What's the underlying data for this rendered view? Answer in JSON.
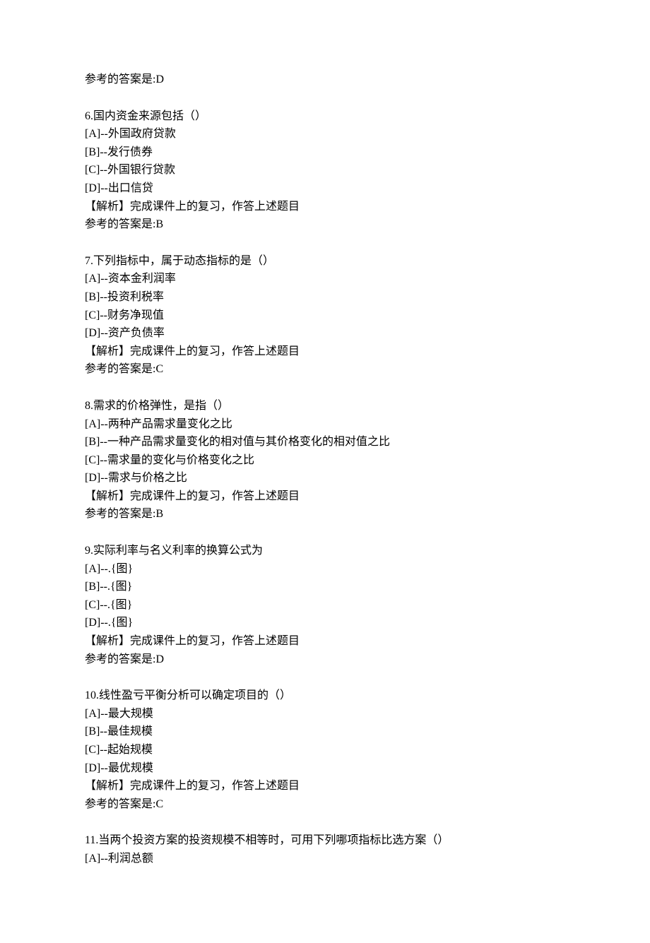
{
  "q5_trail": {
    "answer_line": "参考的答案是:D"
  },
  "q6": {
    "number": "6.",
    "stem": "国内资金来源包括（）",
    "opts": [
      "[A]--外国政府贷款",
      "[B]--发行债券",
      "[C]--外国银行贷款",
      "[D]--出口信贷"
    ],
    "explain": "【解析】完成课件上的复习，作答上述题目",
    "answer_line": "参考的答案是:B"
  },
  "q7": {
    "number": "7.",
    "stem": "下列指标中，属于动态指标的是（）",
    "opts": [
      "[A]--资本金利润率",
      "[B]--投资利税率",
      "[C]--财务净现值",
      "[D]--资产负债率"
    ],
    "explain": "【解析】完成课件上的复习，作答上述题目",
    "answer_line": "参考的答案是:C"
  },
  "q8": {
    "number": "8.",
    "stem": "需求的价格弹性，是指（）",
    "opts": [
      "[A]--两种产品需求量变化之比",
      "[B]--一种产品需求量变化的相对值与其价格变化的相对值之比",
      "[C]--需求量的变化与价格变化之比",
      "[D]--需求与价格之比"
    ],
    "explain": "【解析】完成课件上的复习，作答上述题目",
    "answer_line": "参考的答案是:B"
  },
  "q9": {
    "number": "9.",
    "stem": "实际利率与名义利率的换算公式为",
    "opts": [
      "[A]--.{图}",
      "[B]--.{图}",
      "[C]--.{图}",
      "[D]--.{图}"
    ],
    "explain": "【解析】完成课件上的复习，作答上述题目",
    "answer_line": "参考的答案是:D"
  },
  "q10": {
    "number": "10.",
    "stem": "线性盈亏平衡分析可以确定项目的（）",
    "opts": [
      "[A]--最大规模",
      "[B]--最佳规模",
      "[C]--起始规模",
      "[D]--最优规模"
    ],
    "explain": "【解析】完成课件上的复习，作答上述题目",
    "answer_line": "参考的答案是:C"
  },
  "q11": {
    "number": "11.",
    "stem": "当两个投资方案的投资规模不相等时，可用下列哪项指标比选方案（）",
    "opts": [
      "[A]--利润总额"
    ]
  }
}
